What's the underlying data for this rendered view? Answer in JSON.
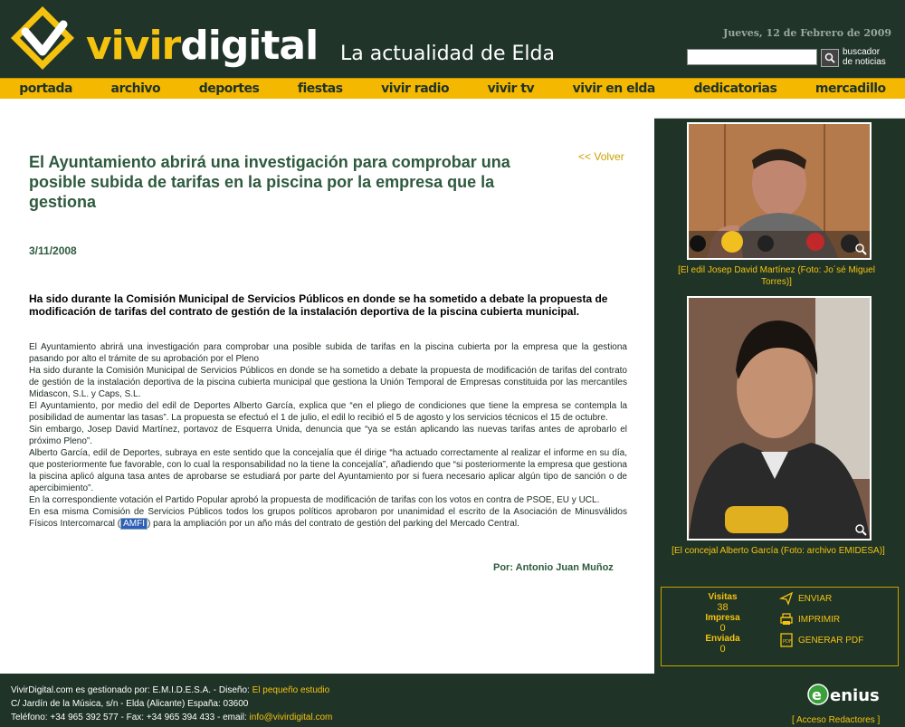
{
  "header": {
    "logo_text_a": "vivir",
    "logo_text_b": "digital",
    "tagline": "La actualidad de Elda",
    "date": "Jueves, 12 de Febrero de 2009",
    "search_placeholder": "",
    "search_label_1": "buscador",
    "search_label_2": "de noticias"
  },
  "nav": [
    "portada",
    "archivo",
    "deportes",
    "fiestas",
    "vivir radio",
    "vivir tv",
    "vivir en elda",
    "dedicatorias",
    "mercadillo"
  ],
  "article": {
    "title": "El Ayuntamiento abrirá una investigación para comprobar una posible subida de tarifas en la piscina por la empresa que la gestiona",
    "back": "<< Volver",
    "date": "3/11/2008",
    "lead": "Ha sido durante la Comisión Municipal de Servicios Públicos en donde se ha sometido a debate la propuesta de modificación de tarifas del contrato de gestión de la instalación deportiva de la piscina cubierta municipal.",
    "paragraphs": [
      "El Ayuntamiento abrirá una investigación para comprobar una posible subida de tarifas en la piscina cubierta por la empresa que la gestiona pasando por alto el trámite de su aprobación por el Pleno",
      "Ha sido durante la Comisión Municipal de Servicios Públicos en donde se ha sometido a debate la propuesta de modificación de tarifas del contrato de gestión de la instalación deportiva de la piscina cubierta municipal que gestiona la Unión Temporal de Empresas constituida por las mercantiles Midascon, S.L. y Caps, S.L.",
      "El Ayuntamiento, por medio del edil de Deportes Alberto García, explica que “en el pliego de condiciones que tiene la empresa se contempla la posibilidad de aumentar las tasas”. La propuesta se efectuó el 1 de julio, el edil lo recibió el 5 de agosto y los servicios técnicos el 15 de octubre.",
      "Sin embargo, Josep David Martínez, portavoz de Esquerra Unida, denuncia que “ya se están aplicando las nuevas tarifas antes de aprobarlo el próximo Pleno”.",
      "Alberto García, edil de Deportes, subraya en este sentido que la concejalía que él dirige “ha actuado correctamente al realizar el informe en su día, que posteriormente fue favorable, con lo cual la responsabilidad no la tiene la concejalía”, añadiendo que “si posteriormente la empresa que gestiona la piscina aplicó alguna tasa antes de aprobarse se estudiará por parte del Ayuntamiento por si fuera necesario aplicar algún tipo de sanción o de apercibimiento”.",
      "En la correspondiente votación el Partido Popular aprobó la propuesta de modificación de tarifas con los votos en contra de PSOE, EU y UCL."
    ],
    "last_a": "En esa misma Comisión de Servicios Públicos todos los grupos políticos aprobaron por unanimidad el escrito de la Asociación de Minusválidos Físicos Intercomarcal (",
    "last_hl": "AMFI",
    "last_b": ") para la ampliación por un año más del contrato de gestión del parking del Mercado Central.",
    "author": "Por: Antonio Juan Muñoz"
  },
  "sidebar": {
    "caption1": "[El edil Josep David Martínez (Foto: Jo´sé Miguel Torres)]",
    "caption2": "[El concejal Alberto García (Foto: archivo EMIDESA)]",
    "visitas_label": "Visitas",
    "visitas": "38",
    "impresa_label": "Impresa",
    "impresa": "0",
    "enviada_label": "Enviada",
    "enviada": "0",
    "enviar": "ENVIAR",
    "imprimir": "IMPRIMIR",
    "pdf": "GENERAR PDF"
  },
  "footer": {
    "line1": "VivirDigital.com es gestionado por: E.M.I.D.E.S.A. - Diseño: ",
    "studio": "El pequeño estudio",
    "line2": "C/ Jardín de la Música, s/n - Elda (Alicante) España: 03600",
    "line3": "Teléfono: +34 965 392 577 - Fax: +34 965 394 433 - email: ",
    "email": "info@vivirdigital.com",
    "enius": "enius",
    "access": "[ Acceso Redactores ]"
  },
  "colors": {
    "accent": "#f5b800",
    "bg": "#1f3327",
    "title": "#2e5a3e"
  }
}
